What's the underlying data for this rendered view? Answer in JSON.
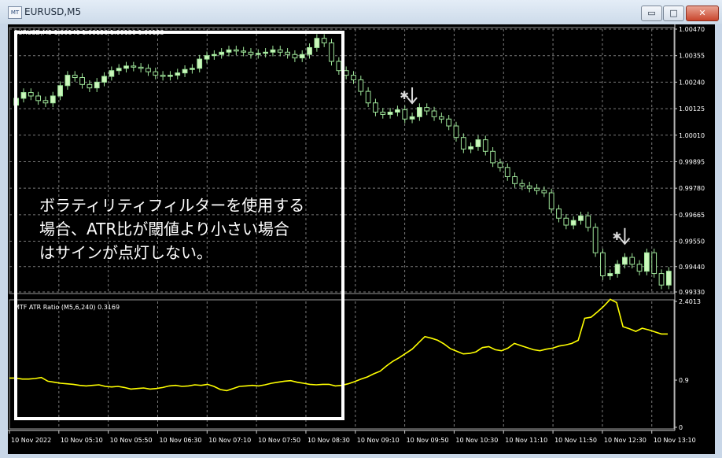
{
  "window": {
    "title": "EURUSD,M5",
    "app_icon_label": "MT",
    "minimize_glyph": "▭",
    "maximize_glyph": "□",
    "close_glyph": "✕"
  },
  "colors": {
    "background": "#000000",
    "grid": "#7a7a7a",
    "bull_candle": "#cbf7bc",
    "bear_candle": "#000000",
    "candle_outline": "#9fe69a",
    "indicator_line": "#ffff00",
    "axis_text": "#ffffff",
    "annotation_text": "#ffffff",
    "signal_arrow": "#d9d9d9"
  },
  "annotation": {
    "lines": [
      "ボラティリティフィルターを使用する",
      "場合、ATR比が閾値より小さい場合",
      "はサインが点灯しない。"
    ]
  },
  "main_header": "EURUSD,M5  1.00140 1.00150 1.00130 1.00133",
  "indicator_header": "MTF ATR Ratio  (M5,6,240) 0.3169",
  "chart_data": [
    {
      "type": "candlestick",
      "symbol": "EURUSD",
      "timeframe": "M5",
      "ylim": [
        0.9933,
        1.0047
      ],
      "y_ticks": [
        "1.00470",
        "1.00355",
        "1.00240",
        "1.00125",
        "1.00010",
        "0.99895",
        "0.99780",
        "0.99665",
        "0.99550",
        "0.99440",
        "0.99330"
      ],
      "x_ticks": [
        "10 Nov 2022",
        "10 Nov 05:10",
        "10 Nov 05:50",
        "10 Nov 06:30",
        "10 Nov 07:10",
        "10 Nov 07:50",
        "10 Nov 08:30",
        "10 Nov 09:10",
        "10 Nov 09:50",
        "10 Nov 10:30",
        "10 Nov 11:10",
        "10 Nov 11:50",
        "10 Nov 12:30",
        "10 Nov 13:10"
      ],
      "close_path": [
        1.0017,
        1.00195,
        1.0018,
        1.0016,
        1.0015,
        1.0018,
        1.00225,
        1.0027,
        1.0026,
        1.0023,
        1.00215,
        1.0024,
        1.00265,
        1.0029,
        1.003,
        1.0031,
        1.00305,
        1.003,
        1.00285,
        1.0027,
        1.00265,
        1.0027,
        1.0028,
        1.00295,
        1.003,
        1.0034,
        1.00355,
        1.0036,
        1.0037,
        1.0038,
        1.00375,
        1.0037,
        1.0036,
        1.00365,
        1.0037,
        1.0038,
        1.0037,
        1.0036,
        1.00345,
        1.0036,
        1.0039,
        1.0043,
        1.0041,
        1.0033,
        1.0029,
        1.0027,
        1.0025,
        1.002,
        1.0015,
        1.0011,
        1.001,
        1.0011,
        1.0012,
        1.0008,
        1.0009,
        1.0013,
        1.00115,
        1.0009,
        1.0008,
        1.0005,
        1.0,
        0.9995,
        0.9996,
        0.9999,
        0.9994,
        0.9989,
        0.9987,
        0.9983,
        0.998,
        0.9979,
        0.9978,
        0.9977,
        0.9976,
        0.9969,
        0.9965,
        0.9962,
        0.9964,
        0.9966,
        0.9961,
        0.995,
        0.994,
        0.9941,
        0.9945,
        0.9948,
        0.9945,
        0.9942,
        0.995,
        0.9941,
        0.9936,
        0.9942
      ],
      "signals": [
        {
          "label": "sell",
          "candle_index": 54
        },
        {
          "label": "sell",
          "candle_index": 83
        }
      ]
    },
    {
      "type": "line",
      "name": "MTF ATR Ratio",
      "ylim": [
        0,
        2.4013
      ],
      "y_ticks": [
        "2.4013",
        "0.9",
        "0"
      ],
      "values": [
        0.94,
        0.94,
        0.92,
        0.92,
        0.93,
        0.95,
        0.88,
        0.86,
        0.84,
        0.83,
        0.82,
        0.8,
        0.79,
        0.8,
        0.81,
        0.78,
        0.77,
        0.78,
        0.76,
        0.73,
        0.74,
        0.75,
        0.73,
        0.74,
        0.76,
        0.79,
        0.8,
        0.78,
        0.79,
        0.81,
        0.8,
        0.82,
        0.78,
        0.72,
        0.7,
        0.74,
        0.78,
        0.79,
        0.8,
        0.79,
        0.81,
        0.84,
        0.86,
        0.88,
        0.89,
        0.86,
        0.84,
        0.82,
        0.81,
        0.82,
        0.82,
        0.79,
        0.8,
        0.83,
        0.87,
        0.92,
        0.96,
        1.02,
        1.07,
        1.17,
        1.26,
        1.33,
        1.41,
        1.49,
        1.61,
        1.73,
        1.7,
        1.66,
        1.59,
        1.5,
        1.45,
        1.4,
        1.41,
        1.44,
        1.52,
        1.54,
        1.48,
        1.46,
        1.51,
        1.6,
        1.56,
        1.52,
        1.48,
        1.46,
        1.49,
        1.51,
        1.55,
        1.57,
        1.6,
        1.66,
        2.08,
        2.1,
        2.2,
        2.31,
        2.44,
        2.38,
        1.92,
        1.88,
        1.83,
        1.89,
        1.86,
        1.82,
        1.78,
        1.78
      ]
    }
  ]
}
